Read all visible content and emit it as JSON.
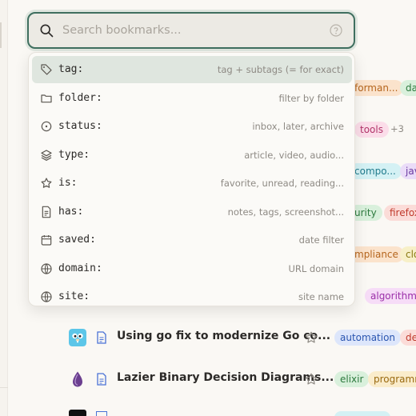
{
  "search": {
    "placeholder": "Search bookmarks...",
    "value": ""
  },
  "dropdown": {
    "options": [
      {
        "key": "tag:",
        "desc": "tag + subtags (= for exact)",
        "icon": "tag-icon"
      },
      {
        "key": "folder:",
        "desc": "filter by folder",
        "icon": "folder-icon"
      },
      {
        "key": "status:",
        "desc": "inbox, later, archive",
        "icon": "status-circle-icon"
      },
      {
        "key": "type:",
        "desc": "article, video, audio...",
        "icon": "layers-icon"
      },
      {
        "key": "is:",
        "desc": "favorite, unread, reading...",
        "icon": "star-icon"
      },
      {
        "key": "has:",
        "desc": "notes, tags, screenshot...",
        "icon": "document-icon"
      },
      {
        "key": "saved:",
        "desc": "date filter",
        "icon": "calendar-icon"
      },
      {
        "key": "domain:",
        "desc": "URL domain",
        "icon": "globe-icon"
      },
      {
        "key": "site:",
        "desc": "site name",
        "icon": "globe-icon"
      }
    ]
  },
  "background_tags": [
    {
      "text": "forman...",
      "color": "#b5651d",
      "bg": "#fbe3cc"
    },
    {
      "text": "da",
      "color": "#2d7a3e",
      "bg": "#d9f0dc"
    },
    {
      "text": "tools",
      "color": "#b2346a",
      "bg": "#fbdde9"
    },
    {
      "text": "+3",
      "color": "#8e8a84",
      "bg": "transparent"
    },
    {
      "text": "compo...",
      "color": "#1f7a8c",
      "bg": "#d4f1f4"
    },
    {
      "text": "jav",
      "color": "#6b3aa0",
      "bg": "#eadcf8"
    },
    {
      "text": "urity",
      "color": "#2d7a3e",
      "bg": "#d9f0dc"
    },
    {
      "text": "firefox",
      "color": "#c0392b",
      "bg": "#fbdcd8"
    },
    {
      "text": "mpliance",
      "color": "#b5651d",
      "bg": "#fbe3cc"
    },
    {
      "text": "clo",
      "color": "#8a7a12",
      "bg": "#f7f0c8"
    },
    {
      "text": "algorithms",
      "color": "#9b2fa8",
      "bg": "#f6dcf7"
    },
    {
      "text": "automation",
      "color": "#2a55b0",
      "bg": "#dde6fb"
    },
    {
      "text": "de",
      "color": "#c0392b",
      "bg": "#fbdcd8"
    },
    {
      "text": "elixir",
      "color": "#2d7a3e",
      "bg": "#d9f0dc"
    },
    {
      "text": "programm",
      "color": "#9a6a10",
      "bg": "#faeccb"
    }
  ],
  "rows": [
    {
      "title": "Using go fix to modernize Go co...",
      "favicon": "gopher-icon"
    },
    {
      "title": "Lazier Binary Decision Diagrams...",
      "favicon": "elixir-drop-icon"
    }
  ]
}
